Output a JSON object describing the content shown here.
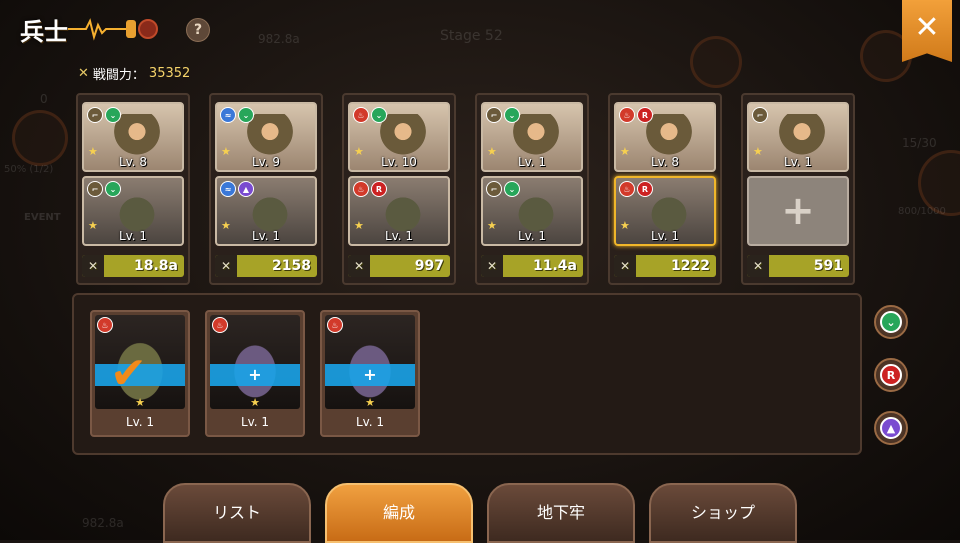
{
  "header": {
    "title": "兵士",
    "help_label": "?",
    "close_label": "✕",
    "power_label": "戦闘力：",
    "power_value": "35352"
  },
  "background": {
    "stage": "Stage 52",
    "coins_top": "982.8a",
    "coins_bottom": "982.8a",
    "ratio": "15/30",
    "progress": "50% (1/2)",
    "event": "EVENT",
    "zero": "0",
    "progress2": "800/1000"
  },
  "squad": [
    {
      "top_lv": "Lv. 8",
      "bot_lv": "Lv. 1",
      "power": "18.8a",
      "top_badges": [
        "gun",
        "green"
      ],
      "bot_badges": [
        "gun",
        "green"
      ]
    },
    {
      "top_lv": "Lv. 9",
      "bot_lv": "Lv. 1",
      "power": "2158",
      "top_badges": [
        "blue",
        "green"
      ],
      "bot_badges": [
        "blue",
        "purple"
      ]
    },
    {
      "top_lv": "Lv. 10",
      "bot_lv": "Lv. 1",
      "power": "997",
      "top_badges": [
        "fire",
        "green"
      ],
      "bot_badges": [
        "fire",
        "r"
      ]
    },
    {
      "top_lv": "Lv. 1",
      "bot_lv": "Lv. 1",
      "power": "11.4a",
      "top_badges": [
        "gun",
        "green"
      ],
      "bot_badges": [
        "gun",
        "green"
      ]
    },
    {
      "top_lv": "Lv. 8",
      "bot_lv": "Lv. 1",
      "power": "1222",
      "top_badges": [
        "fire",
        "r"
      ],
      "bot_badges": [
        "fire",
        "r"
      ]
    },
    {
      "top_lv": "Lv. 1",
      "bot_lv": "",
      "power": "591",
      "top_badges": [
        "gun"
      ],
      "bot_badges": []
    }
  ],
  "inventory": [
    {
      "lv": "Lv. 1",
      "state": "selected"
    },
    {
      "lv": "Lv. 1",
      "state": "add"
    },
    {
      "lv": "Lv. 1",
      "state": "add"
    }
  ],
  "add_symbol": "+",
  "check_symbol": "✔",
  "filters": [
    {
      "label": "⌄",
      "color": "#27a65a"
    },
    {
      "label": "R",
      "color": "#c22"
    },
    {
      "label": "▲",
      "color": "#7a4bd0"
    }
  ],
  "tabs": [
    {
      "label": "リスト",
      "active": false
    },
    {
      "label": "編成",
      "active": true
    },
    {
      "label": "地下牢",
      "active": false
    },
    {
      "label": "ショップ",
      "active": false
    }
  ]
}
